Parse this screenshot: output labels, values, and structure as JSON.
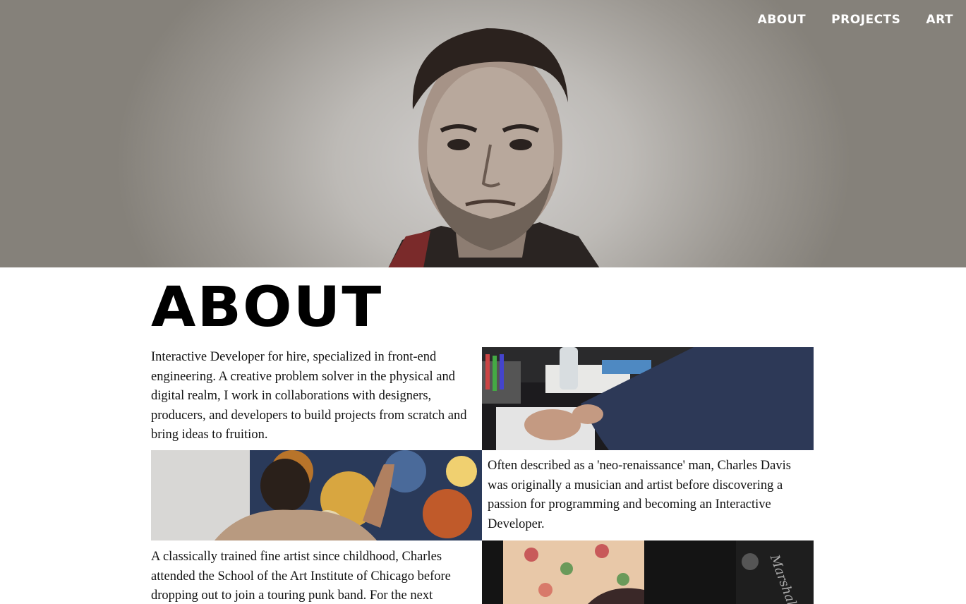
{
  "nav": {
    "items": [
      {
        "label": "ABOUT"
      },
      {
        "label": "PROJECTS"
      },
      {
        "label": "ART"
      }
    ]
  },
  "hero": {
    "image_icon": "portrait-photo"
  },
  "about": {
    "title": "ABOUT",
    "paragraphs": [
      "Interactive Developer for hire, specialized in front-end engineering. A creative problem solver in the physical and digital realm, I work in collaborations with designers, producers, and developers to build projects from scratch and bring ideas to fruition.",
      "Often described as a 'neo-renaissance' man, Charles Davis was originally a musician and artist before discovering a passion for programming and becoming an Interactive Developer.",
      "A classically trained fine artist since childhood, Charles attended the School of the Art Institute of Chicago before dropping out to join a touring punk band. For the next"
    ],
    "photos": [
      {
        "icon": "typing-at-desk-photo"
      },
      {
        "icon": "painting-artwork-photo"
      },
      {
        "icon": "musician-with-amp-photo"
      }
    ]
  },
  "colors": {
    "hero_bg": "#bdbab6",
    "nav_text": "#ffffff",
    "title_text": "#000000"
  }
}
